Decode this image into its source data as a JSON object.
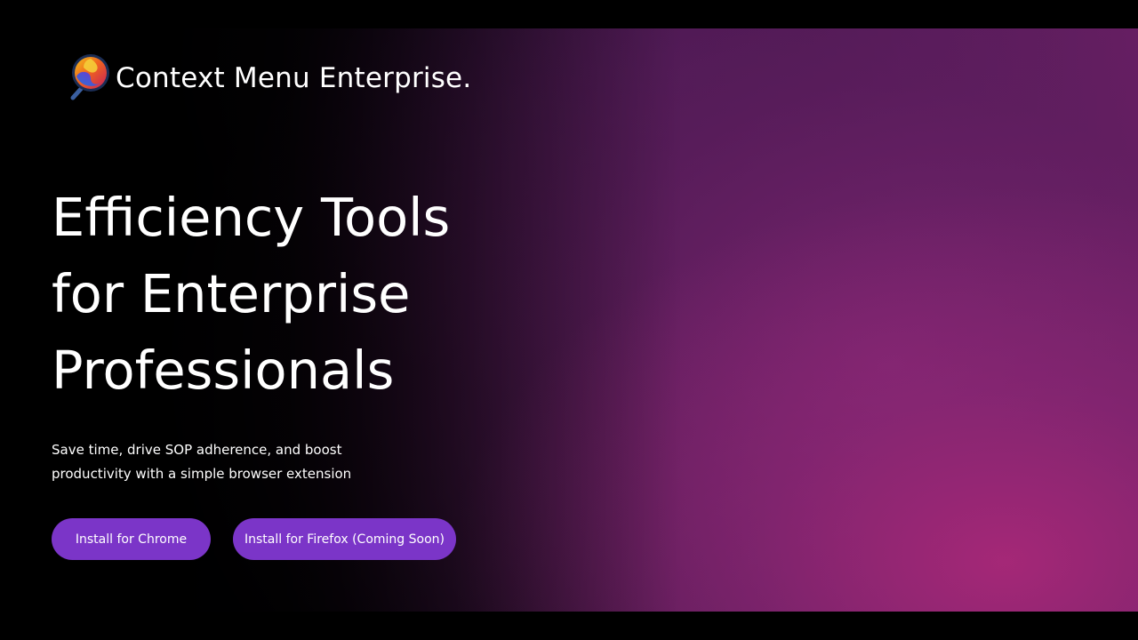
{
  "brand": {
    "name": "Context Menu Enterprise.",
    "logo_icon": "magnifier-logo-icon"
  },
  "hero": {
    "line1": "Efficiency Tools",
    "line2": "for Enterprise",
    "line3": "Professionals"
  },
  "subtitle": {
    "line1": "Save time, drive SOP adherence, and boost",
    "line2": "productivity with a simple browser extension"
  },
  "buttons": {
    "chrome": "Install for Chrome",
    "firefox": "Install for Firefox (Coming Soon)"
  },
  "colors": {
    "button": "#7b35c8",
    "background_dark": "#000000",
    "gradient_magenta": "#a8287a"
  }
}
